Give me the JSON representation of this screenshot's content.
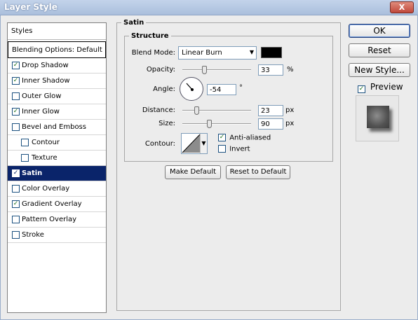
{
  "window": {
    "title": "Layer Style",
    "close_label": "X"
  },
  "styles_panel": {
    "header": "Styles",
    "blending_options": "Blending Options: Default",
    "items": [
      {
        "label": "Drop Shadow",
        "checked": true,
        "sub": false,
        "active": false
      },
      {
        "label": "Inner Shadow",
        "checked": true,
        "sub": false,
        "active": false
      },
      {
        "label": "Outer Glow",
        "checked": false,
        "sub": false,
        "active": false
      },
      {
        "label": "Inner Glow",
        "checked": true,
        "sub": false,
        "active": false
      },
      {
        "label": "Bevel and Emboss",
        "checked": false,
        "sub": false,
        "active": false
      },
      {
        "label": "Contour",
        "checked": false,
        "sub": true,
        "active": false
      },
      {
        "label": "Texture",
        "checked": false,
        "sub": true,
        "active": false
      },
      {
        "label": "Satin",
        "checked": true,
        "sub": false,
        "active": true
      },
      {
        "label": "Color Overlay",
        "checked": false,
        "sub": false,
        "active": false
      },
      {
        "label": "Gradient Overlay",
        "checked": true,
        "sub": false,
        "active": false
      },
      {
        "label": "Pattern Overlay",
        "checked": false,
        "sub": false,
        "active": false
      },
      {
        "label": "Stroke",
        "checked": false,
        "sub": false,
        "active": false
      }
    ]
  },
  "satin": {
    "group_title": "Satin",
    "structure_title": "Structure",
    "blend_mode_label": "Blend Mode:",
    "blend_mode_value": "Linear Burn",
    "blend_color": "#000000",
    "opacity_label": "Opacity:",
    "opacity_value": "33",
    "opacity_unit": "%",
    "angle_label": "Angle:",
    "angle_value": "-54",
    "angle_unit": "°",
    "distance_label": "Distance:",
    "distance_value": "23",
    "distance_unit": "px",
    "size_label": "Size:",
    "size_value": "90",
    "size_unit": "px",
    "contour_label": "Contour:",
    "anti_aliased_label": "Anti-aliased",
    "anti_aliased_checked": true,
    "invert_label": "Invert",
    "invert_checked": false,
    "make_default_label": "Make Default",
    "reset_default_label": "Reset to Default"
  },
  "buttons": {
    "ok": "OK",
    "reset": "Reset",
    "new_style": "New Style...",
    "preview_label": "Preview",
    "preview_checked": true
  },
  "icons": [
    "close-icon",
    "dropdown-arrow-icon",
    "angle-dial-icon",
    "contour-curve-icon",
    "checkbox-icon"
  ]
}
